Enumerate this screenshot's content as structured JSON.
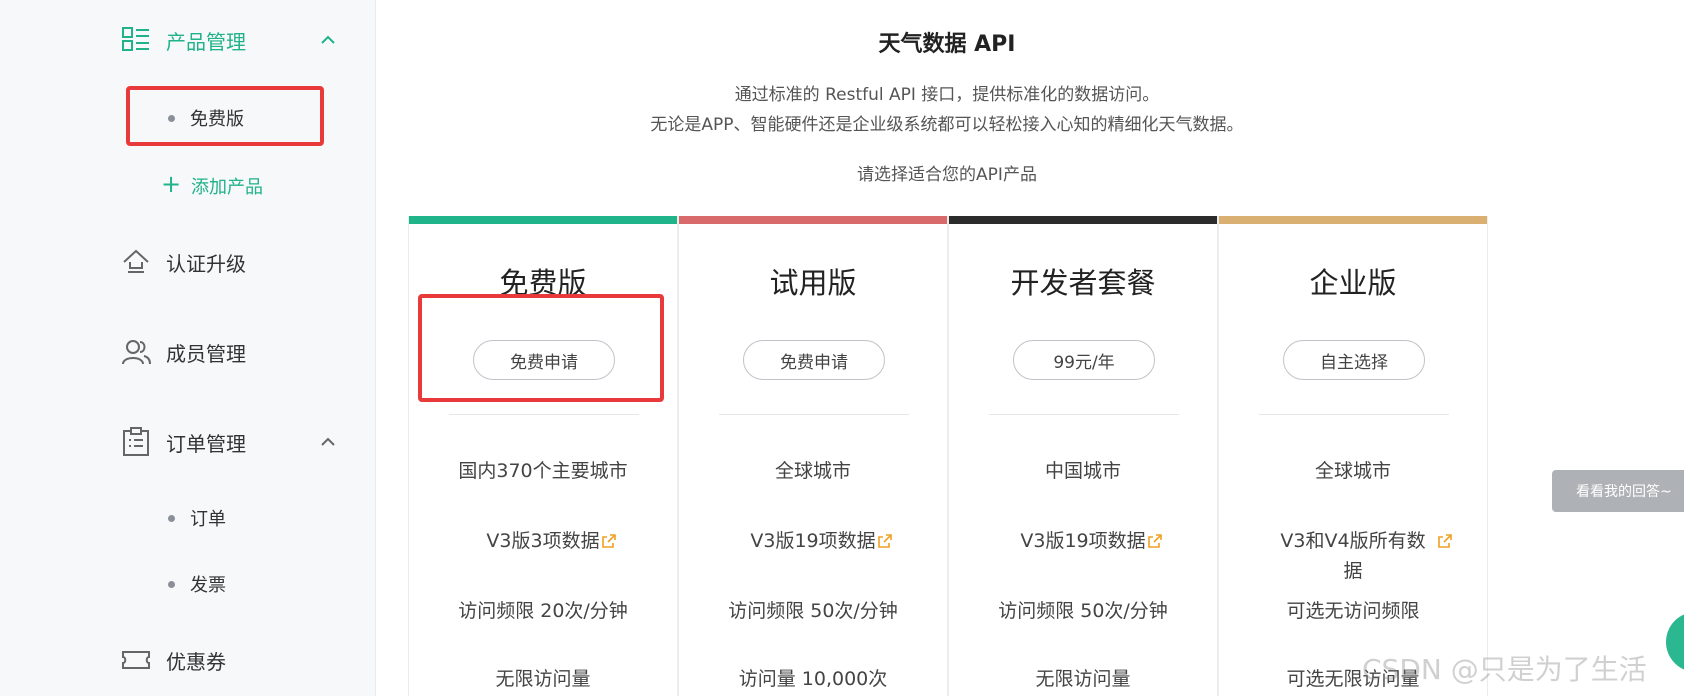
{
  "sidebar": {
    "product": {
      "label": "产品管理",
      "icon": "grid-list-icon",
      "expanded": true
    },
    "product_items": [
      {
        "label": "免费版"
      }
    ],
    "add_product": {
      "label": "添加产品",
      "icon": "plus-icon"
    },
    "auth": {
      "label": "认证升级",
      "icon": "upgrade-icon"
    },
    "members": {
      "label": "成员管理",
      "icon": "users-icon"
    },
    "orders": {
      "label": "订单管理",
      "icon": "clipboard-icon",
      "expanded": true
    },
    "order_items": [
      {
        "label": "订单"
      },
      {
        "label": "发票"
      }
    ],
    "coupons": {
      "label": "优惠券",
      "icon": "ticket-icon"
    }
  },
  "main": {
    "title": "天气数据 API",
    "desc_line1": "通过标准的 Restful API 接口，提供标准化的数据访问。",
    "desc_line2": "无论是APP、智能硬件还是企业级系统都可以轻松接入心知的精细化天气数据。",
    "prompt": "请选择适合您的API产品",
    "plans": [
      {
        "name": "免费版",
        "button": "免费申请",
        "color": "#1fb48a",
        "cities": "国内370个主要城市",
        "data": "V3版3项数据",
        "rate": "访问频限 20次/分钟",
        "volume": "无限访问量"
      },
      {
        "name": "试用版",
        "button": "免费申请",
        "color": "#d86a6c",
        "cities": "全球城市",
        "data": "V3版19项数据",
        "rate": "访问频限 50次/分钟",
        "volume": "访问量 10,000次"
      },
      {
        "name": "开发者套餐",
        "button": "99元/年",
        "color": "#2b2b2b",
        "cities": "中国城市",
        "data": "V3版19项数据",
        "rate": "访问频限 50次/分钟",
        "volume": "无限访问量"
      },
      {
        "name": "企业版",
        "button": "自主选择",
        "color": "#d9b072",
        "cities": "全球城市",
        "data": "V3和V4版所有数据",
        "rate": "可选无访问频限",
        "volume": "可选无限访问量"
      }
    ]
  },
  "float_tag": "看看我的回答~",
  "watermark": "CSDN @只是为了生活",
  "colors": {
    "accent": "#20b28a",
    "highlight": "#e83a3a",
    "link_icon": "#f0a020"
  }
}
